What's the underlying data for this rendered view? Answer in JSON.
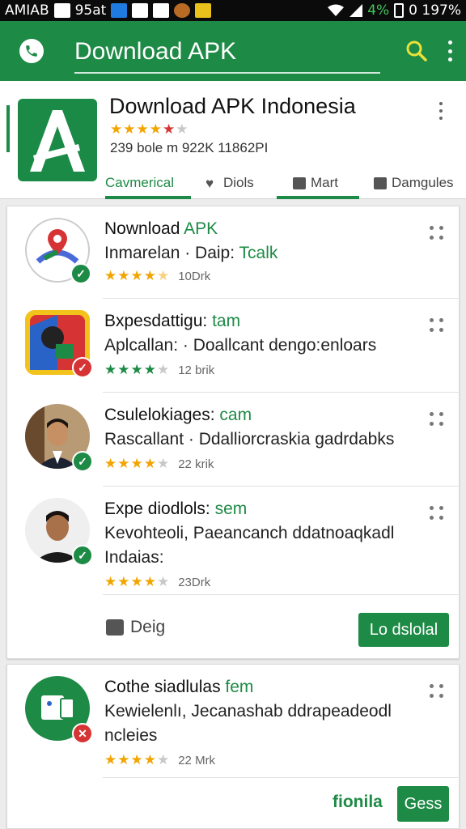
{
  "statusbar": {
    "left_text": "AMIAB",
    "left_text2": "95at",
    "battery_pct": "4%",
    "time": "0 197%"
  },
  "toolbar": {
    "title": "Download APK",
    "icon_phone": "phone-icon",
    "icon_search": "search-icon",
    "icon_more": "more-vert-icon"
  },
  "app": {
    "name": "Download APK Indonesia",
    "stars": "★★★★",
    "stars_half": "★",
    "stars_empty": "★",
    "meta": "239 bole m 922K 11862PI",
    "tabs": [
      {
        "label": "Cavmerical",
        "active": true
      },
      {
        "label": "Diols",
        "active": false
      },
      {
        "label": "Mart",
        "active": true
      },
      {
        "label": "Damgules",
        "active": false
      }
    ]
  },
  "items": [
    {
      "title_a": "Nownload ",
      "title_b": "APK",
      "sub_a": "Inmarelan  ·  Daip: ",
      "sub_b": "Tcalk",
      "sub2": "",
      "stars_full": "★★★★",
      "stars_rest": "★",
      "count": "10Drk",
      "badge": "ok"
    },
    {
      "title_a": "Bxpesdattigu: ",
      "title_b": "tam",
      "sub_a": "Aplcallan:  ·  Doallcant dengo:enloars",
      "sub_b": "",
      "sub2": "",
      "stars_full": "★★★★",
      "stars_rest": "★",
      "count": "12 brik",
      "badge": "err"
    },
    {
      "title_a": "Csulelokiages: ",
      "title_b": "cam",
      "sub_a": "Rascallant  ·  Ddalliorcraskia gadrdabks",
      "sub_b": "",
      "sub2": "",
      "stars_full": "★★★★",
      "stars_rest": "★",
      "count": "22 krik",
      "badge": "ok"
    },
    {
      "title_a": "Expe diodlols: ",
      "title_b": "sem",
      "sub_a": "Kevohteoli, Paeancanch ddatnoaqkadl",
      "sub_b": "",
      "sub2": "Indaias:",
      "stars_full": "★★★★",
      "stars_rest": "★",
      "count": "23Drk",
      "badge": "ok"
    }
  ],
  "card1_footer": {
    "deig_label": "Deig",
    "button_label": "Lo dslolal"
  },
  "card2": {
    "title_a": "Cothe siadlulas ",
    "title_b": "fem",
    "sub": "Kewielenlı, Jecanashab ddrapeadeodl",
    "sub2": "ncleies",
    "stars_full": "★★★★",
    "stars_rest": "★",
    "count": "22 Mrk",
    "link_label": "fionila",
    "button_label": "Gess"
  },
  "colors": {
    "brand_green": "#1d8a45",
    "star_gold": "#f2a500",
    "error_red": "#d63434"
  }
}
